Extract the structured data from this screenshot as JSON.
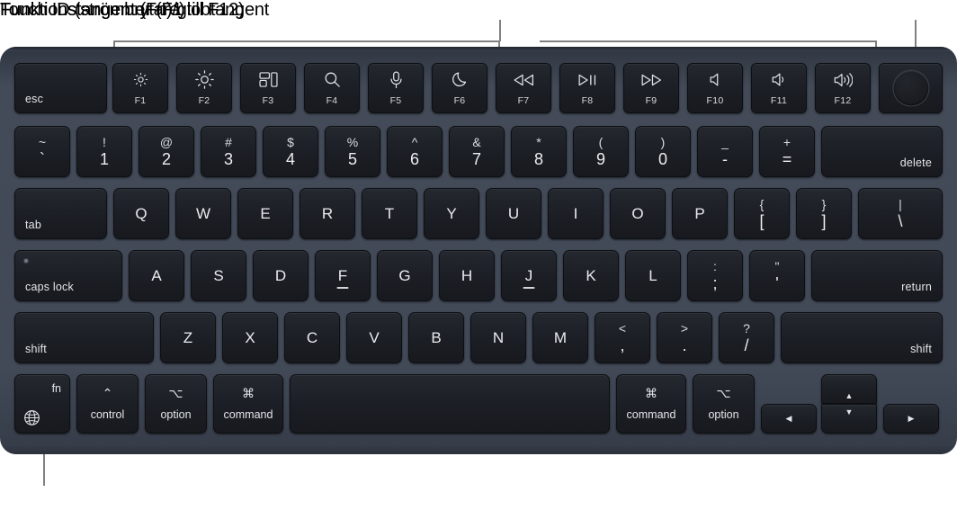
{
  "annotations": {
    "function_keys": "Funktionstangenter (F1 till F12)",
    "touch_id": "Touch ID (strömbrytare)",
    "fn_globe": "Funktionstangent (Fn)/globtangent"
  },
  "colors": {
    "page_background": "#ffffff",
    "chassis": "#424a58",
    "chassis_top_edge": "#20242c",
    "key_face": "#1b1e24",
    "key_border": "#0d0f13",
    "legend_text": "#e8eaed",
    "callout_line": "#808080",
    "callout_text": "#000000"
  },
  "keyboard": {
    "layout": "ANSI US MacBook Magic Keyboard with Touch ID",
    "rows": {
      "function_row": [
        {
          "label": "esc",
          "style": "word-bottom-left"
        },
        {
          "icon": "brightness-down-icon",
          "fnum": "F1"
        },
        {
          "icon": "brightness-up-icon",
          "fnum": "F2"
        },
        {
          "icon": "mission-control-icon",
          "fnum": "F3"
        },
        {
          "icon": "spotlight-search-icon",
          "fnum": "F4"
        },
        {
          "icon": "dictation-microphone-icon",
          "fnum": "F5"
        },
        {
          "icon": "do-not-disturb-moon-icon",
          "fnum": "F6"
        },
        {
          "icon": "rewind-icon",
          "fnum": "F7"
        },
        {
          "icon": "play-pause-icon",
          "fnum": "F8"
        },
        {
          "icon": "fast-forward-icon",
          "fnum": "F9"
        },
        {
          "icon": "mute-icon",
          "fnum": "F10"
        },
        {
          "icon": "volume-down-icon",
          "fnum": "F11"
        },
        {
          "icon": "volume-up-icon",
          "fnum": "F12"
        },
        {
          "icon": "touch-id-icon",
          "label": ""
        }
      ],
      "number_row": [
        {
          "upper": "~",
          "lower": "`"
        },
        {
          "upper": "!",
          "lower": "1"
        },
        {
          "upper": "@",
          "lower": "2"
        },
        {
          "upper": "#",
          "lower": "3"
        },
        {
          "upper": "$",
          "lower": "4"
        },
        {
          "upper": "%",
          "lower": "5"
        },
        {
          "upper": "^",
          "lower": "6"
        },
        {
          "upper": "&",
          "lower": "7"
        },
        {
          "upper": "*",
          "lower": "8"
        },
        {
          "upper": "(",
          "lower": "9"
        },
        {
          "upper": ")",
          "lower": "0"
        },
        {
          "upper": "_",
          "lower": "-"
        },
        {
          "upper": "+",
          "lower": "="
        },
        {
          "label": "delete",
          "style": "word-bottom-right"
        }
      ],
      "top_letter_row": [
        {
          "label": "tab",
          "style": "word-bottom-left"
        },
        {
          "label": "Q"
        },
        {
          "label": "W"
        },
        {
          "label": "E"
        },
        {
          "label": "R"
        },
        {
          "label": "T"
        },
        {
          "label": "Y"
        },
        {
          "label": "U"
        },
        {
          "label": "I"
        },
        {
          "label": "O"
        },
        {
          "label": "P"
        },
        {
          "upper": "{",
          "lower": "["
        },
        {
          "upper": "}",
          "lower": "]"
        },
        {
          "upper": "|",
          "lower": "\\"
        }
      ],
      "home_row": [
        {
          "label": "caps lock",
          "style": "word-bottom-left",
          "led": true
        },
        {
          "label": "A"
        },
        {
          "label": "S"
        },
        {
          "label": "D"
        },
        {
          "label": "F",
          "homing": true
        },
        {
          "label": "G"
        },
        {
          "label": "H"
        },
        {
          "label": "J",
          "homing": true
        },
        {
          "label": "K"
        },
        {
          "label": "L"
        },
        {
          "upper": ":",
          "lower": ";"
        },
        {
          "upper": "\"",
          "lower": "'"
        },
        {
          "label": "return",
          "style": "word-bottom-right"
        }
      ],
      "bottom_letter_row": [
        {
          "label": "shift",
          "style": "word-bottom-left"
        },
        {
          "label": "Z"
        },
        {
          "label": "X"
        },
        {
          "label": "C"
        },
        {
          "label": "V"
        },
        {
          "label": "B"
        },
        {
          "label": "N"
        },
        {
          "label": "M"
        },
        {
          "upper": "<",
          "lower": ","
        },
        {
          "upper": ">",
          "lower": "."
        },
        {
          "upper": "?",
          "lower": "/"
        },
        {
          "label": "shift",
          "style": "word-bottom-right"
        }
      ],
      "modifier_row": [
        {
          "label": "fn",
          "icon": "globe-icon"
        },
        {
          "symbol": "⌃",
          "label": "control"
        },
        {
          "symbol": "⌥",
          "label": "option"
        },
        {
          "symbol": "⌘",
          "label": "command"
        },
        {
          "label": "",
          "name": "space-bar"
        },
        {
          "symbol": "⌘",
          "label": "command"
        },
        {
          "symbol": "⌥",
          "label": "option"
        },
        {
          "icon": "arrow-left-icon",
          "glyph": "◀"
        },
        {
          "icon": "arrow-up-icon",
          "glyph": "▲"
        },
        {
          "icon": "arrow-down-icon",
          "glyph": "▼"
        },
        {
          "icon": "arrow-right-icon",
          "glyph": "▶"
        }
      ]
    }
  }
}
